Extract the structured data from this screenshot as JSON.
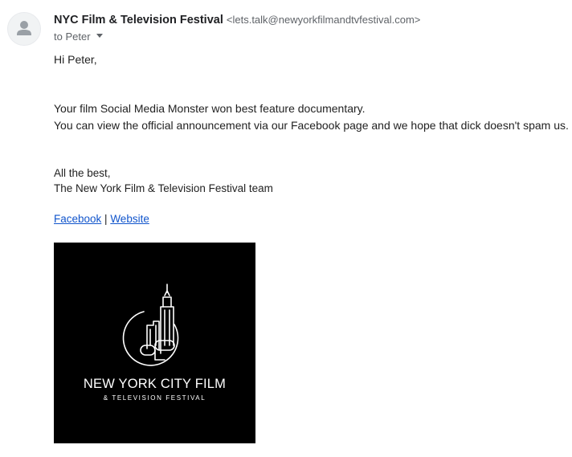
{
  "email": {
    "sender_name": "NYC Film & Television Festival",
    "sender_email": "<lets.talk@newyorkfilmandtvfestival.com>",
    "recipient_line": "to Peter",
    "avatar_icon": "default-person-icon",
    "greeting": "Hi Peter,",
    "body_line_1": "Your film Social Media Monster won best feature documentary.",
    "body_line_2": "You can view the official announcement via our Facebook page and we hope that dick doesn't spam us.",
    "signoff": "All the best,",
    "signature": "The New York Film & Television Festival team",
    "links": {
      "facebook": "Facebook",
      "separator": " | ",
      "website": "Website"
    },
    "logo": {
      "line_1": "NEW YORK CITY FILM",
      "line_2": "& TELEVISION FESTIVAL"
    }
  },
  "colors": {
    "link": "#1155cc",
    "muted_text": "#5f6368",
    "logo_background": "#000000"
  }
}
